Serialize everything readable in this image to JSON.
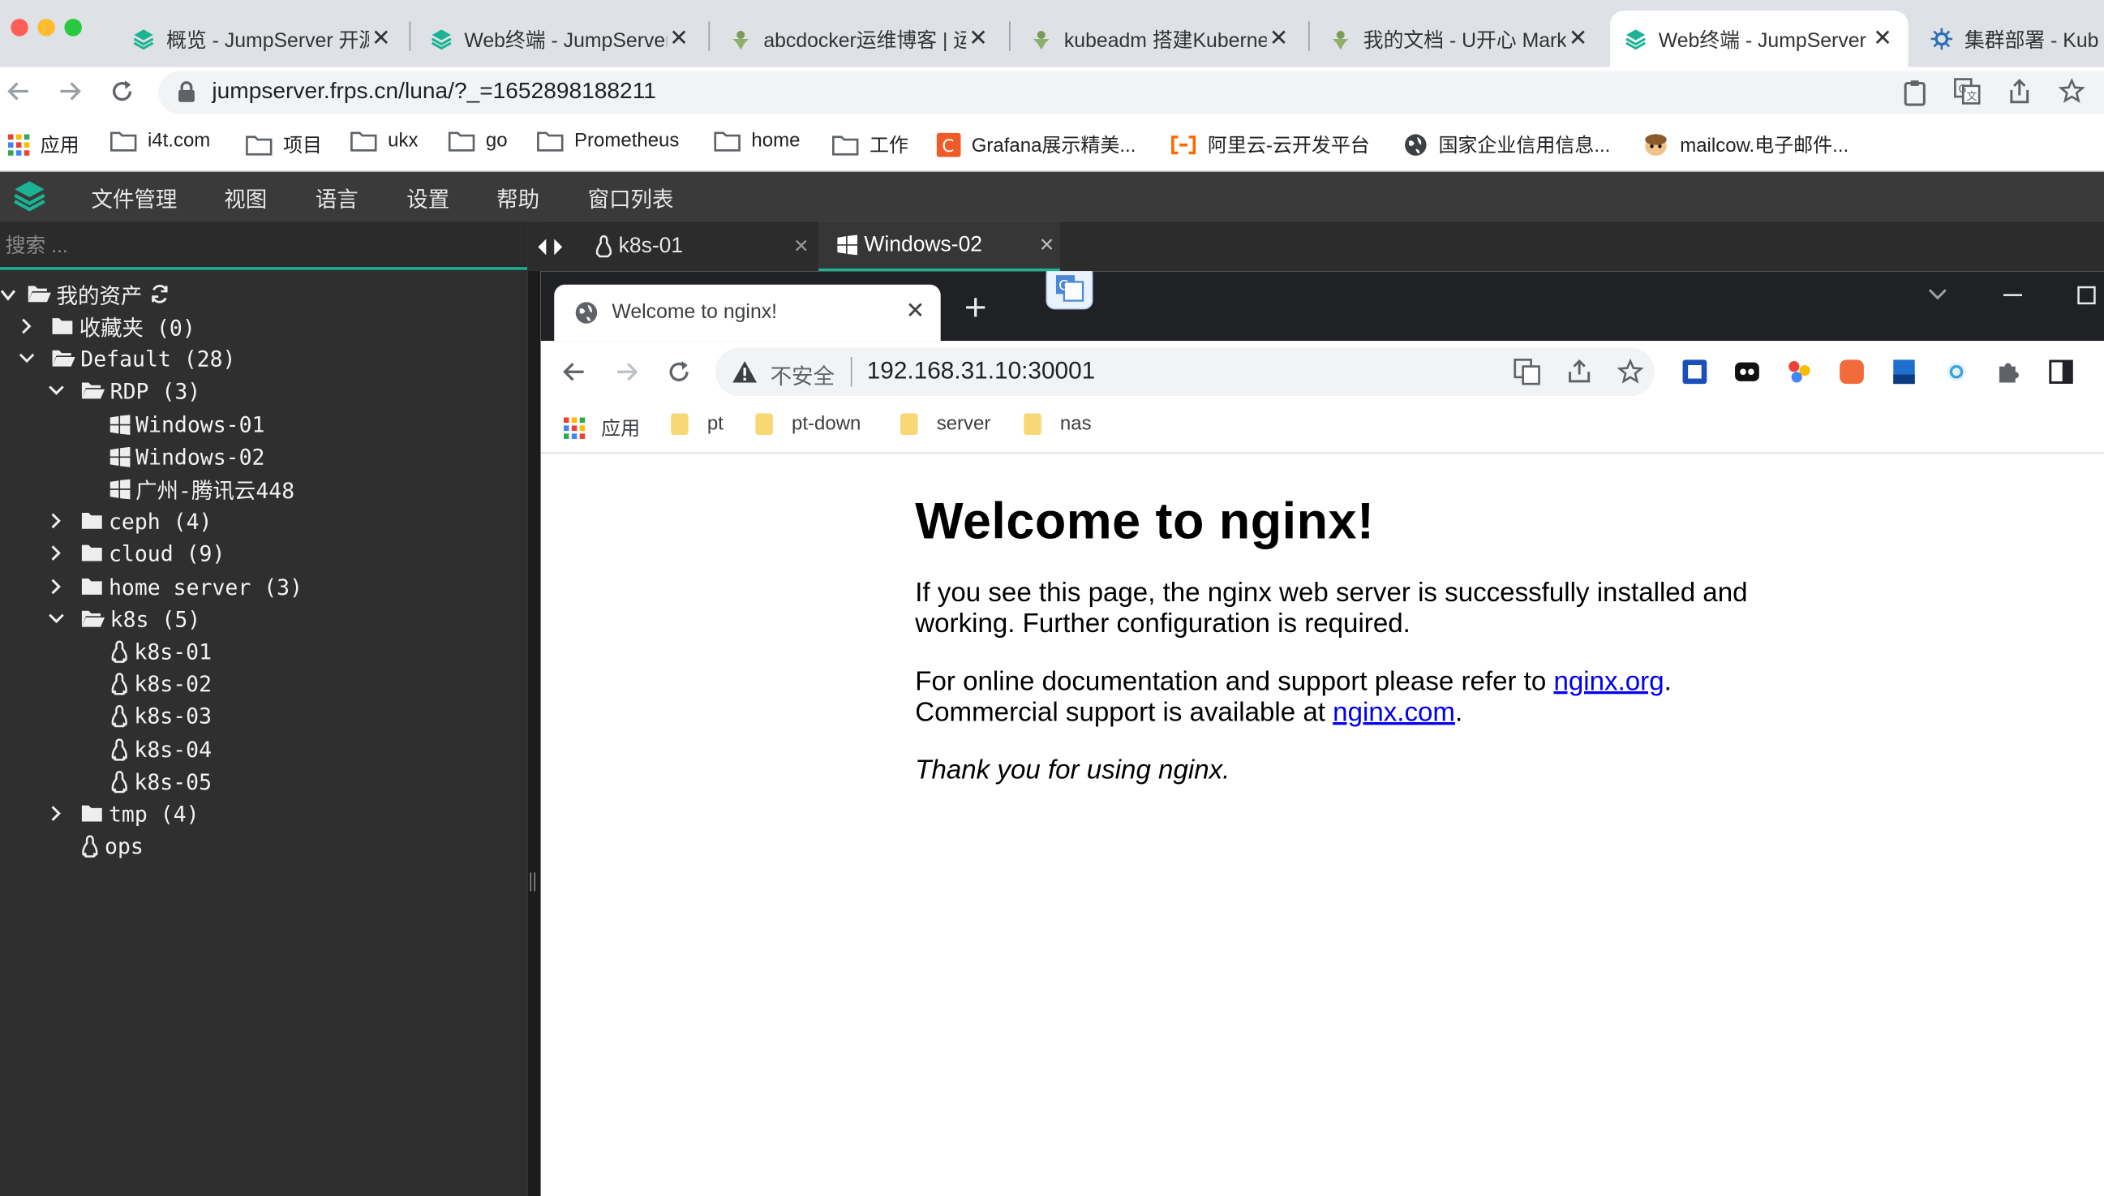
{
  "browser": {
    "tabs": [
      {
        "title": "概览 - JumpServer 开源堡垒机",
        "icon": "jumpserver-icon",
        "active": false
      },
      {
        "title": "Web终端 - JumpServer",
        "icon": "jumpserver-icon",
        "active": false
      },
      {
        "title": "abcdocker运维博客 | 运维",
        "icon": "abcdocker-icon",
        "active": false
      },
      {
        "title": "kubeadm 搭建Kubernetes",
        "icon": "abcdocker-icon",
        "active": false
      },
      {
        "title": "我的文档 - U开心 Markdown",
        "icon": "abcdocker-icon",
        "active": false
      },
      {
        "title": "Web终端 - JumpServer",
        "icon": "jumpserver-icon",
        "active": true
      },
      {
        "title": "集群部署 - Kub",
        "icon": "helm-icon",
        "active": false
      }
    ],
    "url": "jumpserver.frps.cn/luna/?_=1652898188211",
    "bookmarks": [
      {
        "label": "应用",
        "icon": "apps-grid-icon"
      },
      {
        "label": "i4t.com",
        "icon": "folder-icon"
      },
      {
        "label": "项目",
        "icon": "folder-icon"
      },
      {
        "label": "ukx",
        "icon": "folder-icon"
      },
      {
        "label": "go",
        "icon": "folder-icon"
      },
      {
        "label": "Prometheus",
        "icon": "folder-icon"
      },
      {
        "label": "home",
        "icon": "folder-icon"
      },
      {
        "label": "工作",
        "icon": "folder-icon"
      },
      {
        "label": "Grafana展示精美...",
        "icon": "grafana-icon"
      },
      {
        "label": "阿里云-云开发平台",
        "icon": "aliyun-icon"
      },
      {
        "label": "国家企业信用信息...",
        "icon": "globe-icon"
      },
      {
        "label": "mailcow.电子邮件...",
        "icon": "mailcow-icon"
      }
    ]
  },
  "menu": {
    "items": [
      "文件管理",
      "视图",
      "语言",
      "设置",
      "帮助",
      "窗口列表"
    ]
  },
  "sidebar": {
    "search_placeholder": "搜索 ...",
    "tree": [
      {
        "label": "我的资产",
        "type": "root",
        "level": 0,
        "expanded": true,
        "icon": "folder-open-icon"
      },
      {
        "label": "收藏夹 (0)",
        "type": "folder",
        "level": 1,
        "expanded": false,
        "icon": "folder-icon"
      },
      {
        "label": "Default (28)",
        "type": "folder",
        "level": 1,
        "expanded": true,
        "icon": "folder-open-icon"
      },
      {
        "label": "RDP (3)",
        "type": "folder",
        "level": 2,
        "expanded": true,
        "icon": "folder-open-icon"
      },
      {
        "label": "Windows-01",
        "type": "windows",
        "level": 3,
        "icon": "windows-icon"
      },
      {
        "label": "Windows-02",
        "type": "windows",
        "level": 3,
        "icon": "windows-icon"
      },
      {
        "label": "广州-腾讯云448",
        "type": "windows",
        "level": 3,
        "icon": "windows-icon"
      },
      {
        "label": "ceph (4)",
        "type": "folder",
        "level": 2,
        "expanded": false,
        "icon": "folder-icon"
      },
      {
        "label": "cloud (9)",
        "type": "folder",
        "level": 2,
        "expanded": false,
        "icon": "folder-icon"
      },
      {
        "label": "home server (3)",
        "type": "folder",
        "level": 2,
        "expanded": false,
        "icon": "folder-icon"
      },
      {
        "label": "k8s (5)",
        "type": "folder",
        "level": 2,
        "expanded": true,
        "icon": "folder-open-icon"
      },
      {
        "label": "k8s-01",
        "type": "linux",
        "level": 3,
        "icon": "linux-icon"
      },
      {
        "label": "k8s-02",
        "type": "linux",
        "level": 3,
        "icon": "linux-icon"
      },
      {
        "label": "k8s-03",
        "type": "linux",
        "level": 3,
        "icon": "linux-icon"
      },
      {
        "label": "k8s-04",
        "type": "linux",
        "level": 3,
        "icon": "linux-icon"
      },
      {
        "label": "k8s-05",
        "type": "linux",
        "level": 3,
        "icon": "linux-icon"
      },
      {
        "label": "tmp (4)",
        "type": "folder",
        "level": 2,
        "expanded": false,
        "icon": "folder-icon"
      },
      {
        "label": "ops",
        "type": "linux",
        "level": 2,
        "icon": "linux-icon"
      }
    ]
  },
  "terminal_tabs": [
    {
      "label": "k8s-01",
      "icon": "linux-icon",
      "active": false
    },
    {
      "label": "Windows-02",
      "icon": "windows-icon",
      "active": true
    }
  ],
  "remote": {
    "tab_title": "Welcome to nginx!",
    "security_label": "不安全",
    "address": "192.168.31.10:30001",
    "bookmarks": [
      {
        "label": "应用",
        "icon": "apps-grid-icon"
      },
      {
        "label": "pt",
        "icon": "folder-icon"
      },
      {
        "label": "pt-down",
        "icon": "folder-icon"
      },
      {
        "label": "server",
        "icon": "folder-icon"
      },
      {
        "label": "nas",
        "icon": "folder-icon"
      }
    ],
    "page": {
      "heading": "Welcome to nginx!",
      "para1": "If you see this page, the nginx web server is successfully installed and working. Further configuration is required.",
      "para2_prefix": "For online documentation and support please refer to ",
      "link1": "nginx.org",
      "para2_mid": ".",
      "para2_line2": "Commercial support is available at ",
      "link2": "nginx.com",
      "para2_end": ".",
      "para3": "Thank you for using nginx."
    }
  },
  "colors": {
    "accent": "#1ab394",
    "sidebar_bg": "#2f2f2f",
    "menubar_bg": "#3a3a3a",
    "link": "#0000ee"
  }
}
